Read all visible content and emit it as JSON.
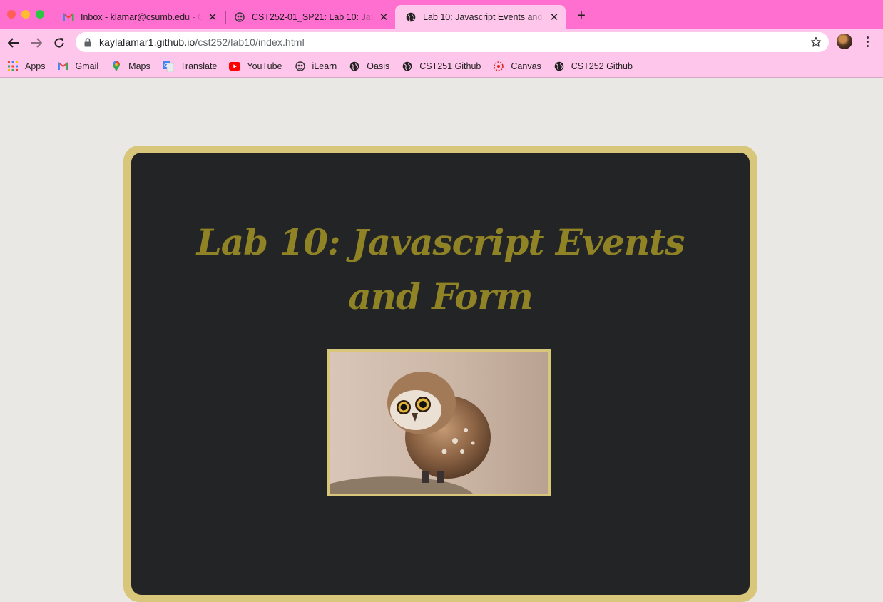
{
  "window": {
    "controls": [
      "close",
      "minimize",
      "zoom"
    ]
  },
  "tabs": [
    {
      "title": "Inbox - klamar@csumb.edu - G",
      "favicon": "gmail-icon",
      "active": false
    },
    {
      "title": "CST252-01_SP21: Lab 10: Java",
      "favicon": "ilearn-icon",
      "active": false
    },
    {
      "title": "Lab 10: Javascript Events and F",
      "favicon": "globe-icon",
      "active": true
    }
  ],
  "toolbar": {
    "url_host": "kaylalamar1.github.io",
    "url_path": "/cst252/lab10/index.html"
  },
  "bookmarks": [
    {
      "label": "Apps",
      "icon": "apps-grid-icon"
    },
    {
      "label": "Gmail",
      "icon": "gmail-icon"
    },
    {
      "label": "Maps",
      "icon": "maps-pin-icon"
    },
    {
      "label": "Translate",
      "icon": "translate-icon"
    },
    {
      "label": "YouTube",
      "icon": "youtube-icon"
    },
    {
      "label": "iLearn",
      "icon": "ilearn-icon"
    },
    {
      "label": "Oasis",
      "icon": "globe-icon"
    },
    {
      "label": "CST251 Github",
      "icon": "globe-icon"
    },
    {
      "label": "Canvas",
      "icon": "canvas-icon"
    },
    {
      "label": "CST252 Github",
      "icon": "globe-icon"
    }
  ],
  "page": {
    "heading": "Lab 10: Javascript Events and Form",
    "image_alt": "owl photo",
    "colors": {
      "background": "#e9e8e4",
      "card": "#232425",
      "card_border": "#d8c77a",
      "heading": "#8f8325"
    }
  }
}
